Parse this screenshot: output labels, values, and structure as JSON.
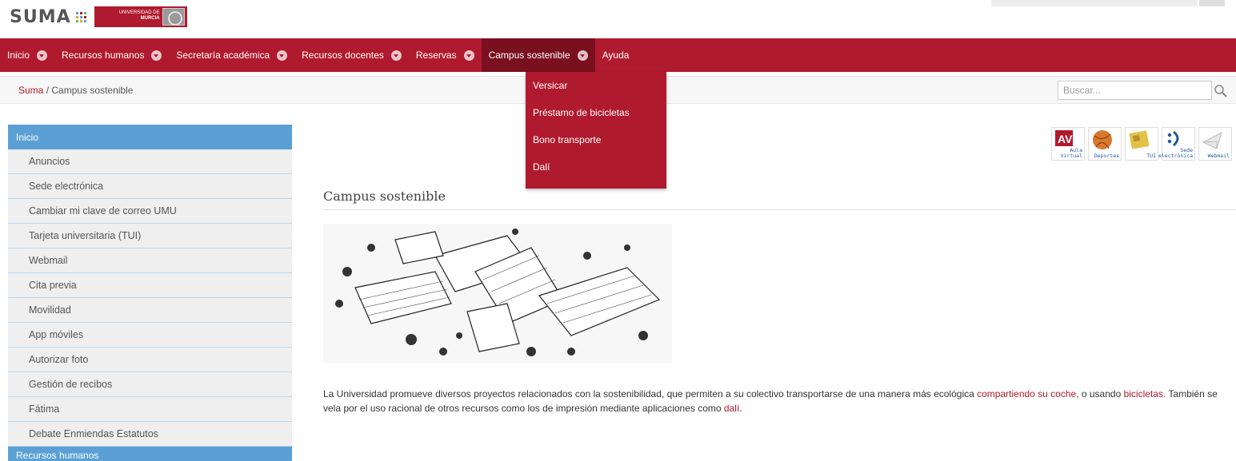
{
  "header": {
    "logo_text": "SUMA",
    "badge_line1": "UNIVERSIDAD DE",
    "badge_line2": "MURCIA",
    "dot_colors": [
      "#5aa0d4",
      "#b01a2e",
      "#7ab648",
      "#e8a02c",
      "#5aa0d4",
      "#b01a2e",
      "#7ab648",
      "#e8a02c",
      "#5aa0d4"
    ]
  },
  "nav": {
    "items": [
      {
        "label": "Inicio"
      },
      {
        "label": "Recursos humanos"
      },
      {
        "label": "Secretaría académica"
      },
      {
        "label": "Recursos docentes"
      },
      {
        "label": "Reservas"
      },
      {
        "label": "Campus sostenible"
      },
      {
        "label": "Ayuda"
      }
    ],
    "active": "Campus sostenible"
  },
  "dropdown": {
    "items": [
      "Versicar",
      "Préstamo de bicicletas",
      "Bono transporte",
      "Dalí"
    ]
  },
  "breadcrumb": {
    "root": "Suma",
    "separator": " / ",
    "current": "Campus sostenible"
  },
  "search": {
    "placeholder": "Buscar..."
  },
  "sidebar": {
    "header": "Inicio",
    "items": [
      "Anuncios",
      "Sede electrónica",
      "Cambiar mi clave de correo UMU",
      "Tarjeta universitaria (TUI)",
      "Webmail",
      "Cita previa",
      "Movilidad",
      "App móviles",
      "Autorizar foto",
      "Gestión de recibos",
      "Fátima",
      "Debate Enmiendas Estatutos"
    ],
    "next_header": "Recursos humanos"
  },
  "quicklinks": [
    {
      "label1": "Aula",
      "label2": "Virtual",
      "icon": "aula-virtual-icon"
    },
    {
      "label1": "",
      "label2": "Deportes",
      "icon": "deportes-icon"
    },
    {
      "label1": "",
      "label2": "TUI",
      "icon": "tui-icon"
    },
    {
      "label1": "Sede",
      "label2": "electrónica",
      "icon": "sede-electronica-icon"
    },
    {
      "label1": "",
      "label2": "Webmail",
      "icon": "webmail-icon"
    }
  ],
  "main": {
    "title": "Campus sostenible",
    "text_1": "La Universidad promueve diversos proyectos relacionados con la sostenibilidad, que permiten a su colectivo transportarse de una manera más ecológica ",
    "link_1": "compartiendo su coche",
    "text_2": ", o usando ",
    "link_2": "bicicletas",
    "text_3": ". También se vela por el uso racional de otros recursos como los de impresión mediante aplicaciones como ",
    "link_3": "dalí",
    "text_4": "."
  },
  "colors": {
    "brand": "#b01a2e",
    "brand_dark": "#7a0f1f",
    "sidebar_header": "#5aa0d4"
  }
}
